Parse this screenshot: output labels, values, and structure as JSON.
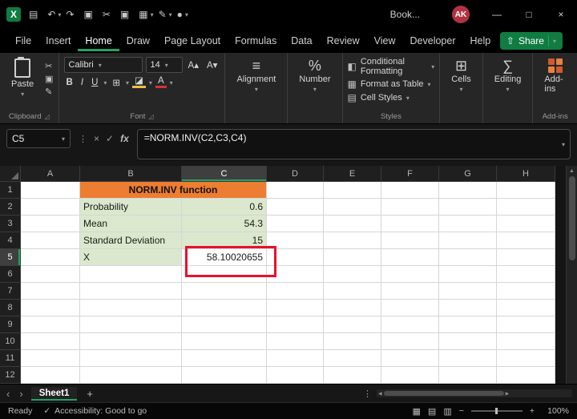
{
  "colors": {
    "accent_green": "#21A366",
    "share_green": "#107C41",
    "header_orange": "#ED7D31",
    "fill_green": "#DBE8CD",
    "annotation_red": "#E8112D"
  },
  "icons": {
    "logo": "X",
    "save": "▤",
    "undo": "↶",
    "redo": "↷",
    "clipboard": "▣",
    "cut": "✂",
    "copy": "▣",
    "pen": "✎",
    "circle": "●",
    "chv": "▾",
    "x": "×",
    "check": "✓",
    "fx": "fx",
    "min": "—",
    "max": "□",
    "close": "×",
    "share": "⇧",
    "borders": "⊞",
    "fill": "◪",
    "alpha": "A",
    "bold": "B",
    "italic": "I",
    "under": "U",
    "align": "≡",
    "pct": "%",
    "cf": "◧",
    "ftable": "▦",
    "cstyles": "▤",
    "cells": "⊞",
    "sum": "∑",
    "launcher": "◿",
    "up": "▲",
    "left": "◀",
    "right": "▶",
    "plus": "+",
    "minus": "−",
    "navl": "‹",
    "navr": "›",
    "dots": "⋮",
    "grid1": "▦",
    "grid2": "▤",
    "grid3": "▥",
    "sizeup": "A▴",
    "sizedn": "A▾",
    "acc": "✓"
  },
  "titlebar": {
    "workbook": "Book...",
    "avatar": "AK"
  },
  "menubar": {
    "items": [
      "File",
      "Insert",
      "Home",
      "Draw",
      "Page Layout",
      "Formulas",
      "Data",
      "Review",
      "View",
      "Developer",
      "Help"
    ],
    "active": "Home",
    "share": "Share"
  },
  "ribbon": {
    "clipboard": {
      "paste_label": "Paste",
      "group_label": "Clipboard"
    },
    "font": {
      "family": "Calibri",
      "size": "14",
      "group_label": "Font"
    },
    "alignment": {
      "label": "Alignment"
    },
    "number": {
      "label": "Number"
    },
    "styles": {
      "items": [
        "Conditional Formatting",
        "Format as Table",
        "Cell Styles"
      ],
      "group_label": "Styles"
    },
    "cells": {
      "label": "Cells"
    },
    "editing": {
      "label": "Editing"
    },
    "addins": {
      "label": "Add-ins",
      "group_label": "Add-ins"
    }
  },
  "formula_bar": {
    "name_box": "C5",
    "formula": "=NORM.INV(C2,C3,C4)"
  },
  "sheet": {
    "columns": [
      "A",
      "B",
      "C",
      "D",
      "E",
      "F",
      "G",
      "H"
    ],
    "rows": [
      "1",
      "2",
      "3",
      "4",
      "5",
      "6",
      "7",
      "8",
      "9",
      "10",
      "11",
      "12"
    ],
    "title": "NORM.INV function",
    "data": [
      {
        "label": "Probability",
        "value": "0.6"
      },
      {
        "label": "Mean",
        "value": "54.3"
      },
      {
        "label": "Standard Deviation",
        "value": "15"
      },
      {
        "label": "X",
        "value": "58.10020655"
      }
    ],
    "selected": "C5"
  },
  "tabs": {
    "sheet": "Sheet1"
  },
  "status": {
    "mode": "Ready",
    "accessibility": "Accessibility: Good to go",
    "zoom": "100%"
  }
}
